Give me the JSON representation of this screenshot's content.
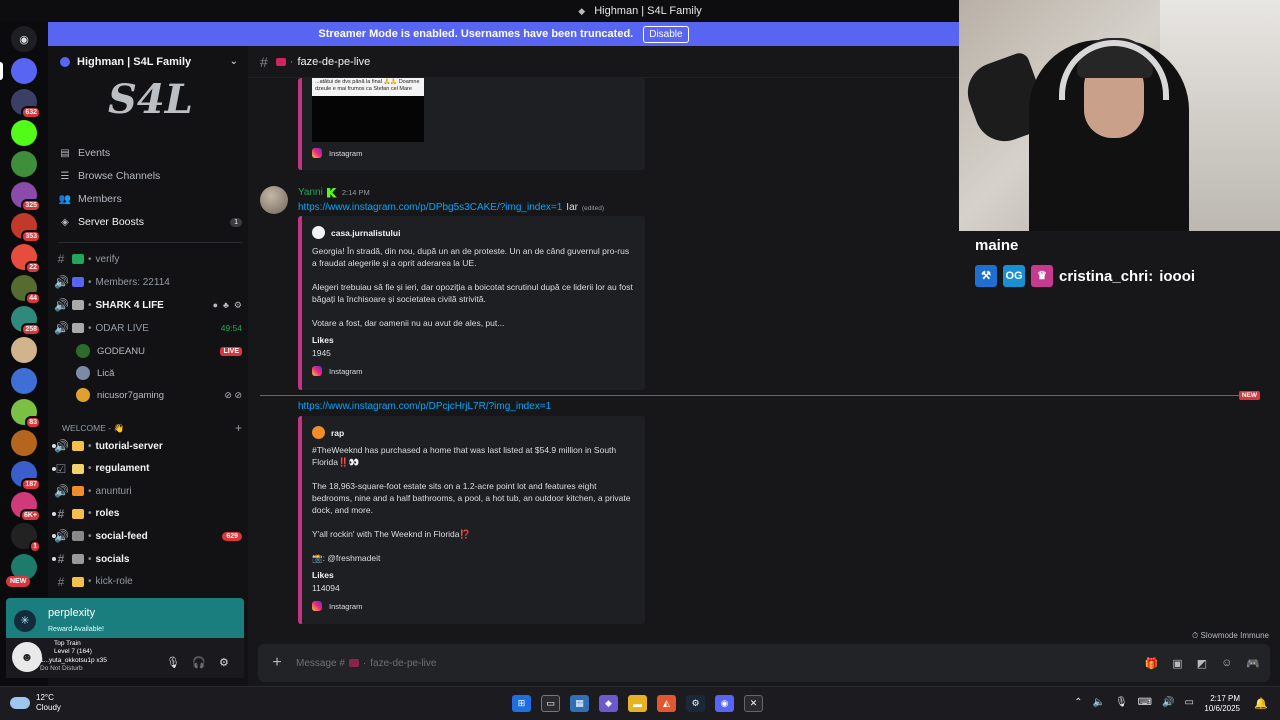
{
  "window": {
    "title": "Highman | S4L Family"
  },
  "streamer_banner": {
    "text": "Streamer Mode is enabled. Usernames have been truncated.",
    "button": "Disable"
  },
  "rail": {
    "servers": [
      {
        "color": "#5865f2",
        "badge": ""
      },
      {
        "color": "#3a3f66",
        "badge": "632"
      },
      {
        "color": "#53fc18",
        "badge": ""
      },
      {
        "color": "#3f8f3a",
        "badge": ""
      },
      {
        "color": "#8b4ba8",
        "badge": "325"
      },
      {
        "color": "#c0392b",
        "badge": "353"
      },
      {
        "color": "#e74c3c",
        "badge": "22"
      },
      {
        "color": "#556b2f",
        "badge": "44"
      },
      {
        "color": "#2f8a7c",
        "badge": "258"
      },
      {
        "color": "#d2b48c",
        "badge": ""
      },
      {
        "color": "#3d6fd6",
        "badge": ""
      },
      {
        "color": "#7ac143",
        "badge": "83"
      },
      {
        "color": "#b5651d",
        "badge": ""
      },
      {
        "color": "#3a5fcd",
        "badge": "187"
      },
      {
        "color": "#d13a7a",
        "badge": "6K+"
      },
      {
        "color": "#222",
        "badge": "1"
      },
      {
        "color": "#1e7b6b",
        "badge": ""
      }
    ],
    "new_label": "NEW"
  },
  "sidebar": {
    "server_name": "Highman | S4L Family",
    "banner_art": "S4L",
    "nav": [
      {
        "icon": "calendar-icon",
        "glyph": "▤",
        "label": "Events",
        "count": ""
      },
      {
        "icon": "browse-channels-icon",
        "glyph": "☰",
        "label": "Browse Channels",
        "count": ""
      },
      {
        "icon": "members-icon",
        "glyph": "👥",
        "label": "Members",
        "count": ""
      },
      {
        "icon": "boost-icon",
        "glyph": "◈",
        "label": "Server Boosts",
        "count": "1"
      }
    ],
    "channels": [
      {
        "type": "#",
        "emo": "#23a55a",
        "label": "verify",
        "bright": false
      },
      {
        "type": "🔊",
        "emo": "#5865f2",
        "label": "Members: 22114",
        "bright": false
      },
      {
        "type": "🔊",
        "emo": "#aaa",
        "label": "SHARK 4 LIFE",
        "bright": true
      },
      {
        "type": "🔊",
        "emo": "#aaa",
        "label": "ODAR LIVE",
        "bright": false,
        "timer": "49:54"
      }
    ],
    "voice_users": [
      {
        "name": "GODEANU",
        "color": "#2d6b2d",
        "live": "LIVE"
      },
      {
        "name": "Lică",
        "color": "#7a8aa8",
        "live": ""
      },
      {
        "name": "nicusor7gaming",
        "color": "#e0a030",
        "live": ""
      }
    ],
    "category": "WELCOME - 👋",
    "channels2": [
      {
        "type": "🔊",
        "emo": "#f5c04a",
        "label": "tutorial-server",
        "bright": true,
        "count": ""
      },
      {
        "type": "☑",
        "emo": "#f0d36b",
        "label": "regulament",
        "bright": true,
        "count": ""
      },
      {
        "type": "🔊",
        "emo": "#f08c2a",
        "label": "anunturi",
        "bright": false,
        "count": ""
      },
      {
        "type": "#",
        "emo": "#f5c04a",
        "label": "roles",
        "bright": true,
        "count": ""
      },
      {
        "type": "🔊",
        "emo": "#888",
        "label": "social-feed",
        "bright": true,
        "count": "629"
      },
      {
        "type": "#",
        "emo": "#999",
        "label": "socials",
        "bright": true,
        "count": ""
      },
      {
        "type": "#",
        "emo": "#f5c04a",
        "label": "kick-role",
        "bright": false,
        "count": ""
      }
    ]
  },
  "promo": {
    "title": "perplexity",
    "subtitle": "Reward Available!"
  },
  "user_panel": {
    "line1": "Top Train",
    "line2": "Level 7 (164)",
    "line3": "1...yuta_okkotsu1p x35",
    "line4": "Do Not Disturb"
  },
  "chat": {
    "channel_name": "faze-de-pe-live",
    "embed0": {
      "thumb_caption": "...atâtui de dvs până la final 🙏🙏 Doamne dzeule e mai frumos ca Stefan cel Mare",
      "footer": "Instagram"
    },
    "message": {
      "author": "Yanni",
      "time": "2:14 PM",
      "link": "https://www.instagram.com/p/DPbg5s3CAKE/?img_index=1",
      "after": "Iar",
      "edited": "(edited)"
    },
    "embed1": {
      "author": "casa.jurnalistului",
      "description": "Georgia! În stradă, din nou, după un an de proteste. Un an de când guvernul pro-rus a fraudat alegerile și a oprit aderarea la UE.\n\nAlegeri trebuiau să fie și ieri, dar opoziția a boicotat scrutinul după ce liderii lor au fost băgați la închisoare și societatea civilă strivită.\n\nVotare a fost, dar oamenii nu au avut de ales, put...",
      "field_label": "Likes",
      "field_value": "1945",
      "footer": "Instagram"
    },
    "new_label": "NEW",
    "link2": "https://www.instagram.com/p/DPcjcHrjL7R/?img_index=1",
    "embed2": {
      "author": "rap",
      "description": "#TheWeeknd has purchased a home that was last listed at $54.9 million in South Florida‼️👀\n\nThe 18,963-square-foot estate sits on a 1.2-acre point lot and features eight bedrooms, nine and a half bathrooms, a pool, a hot tub, an outdoor kitchen, a private dock, and more.\n\nY'all rockin' with The Weeknd in Florida⁉️\n\n📸: @freshmadeit",
      "field_label": "Likes",
      "field_value": "114094",
      "footer": "Instagram"
    },
    "slowmode": "Slowmode Immune",
    "composer_prefix": "Message #",
    "composer_channel": "faze-de-pe-live"
  },
  "overlay": {
    "line1": "maine",
    "user": "cristina_chri:",
    "text": "ioooi"
  },
  "taskbar": {
    "temp": "12°C",
    "weather": "Cloudy",
    "time": "2:17 PM",
    "date": "10/6/2025"
  }
}
